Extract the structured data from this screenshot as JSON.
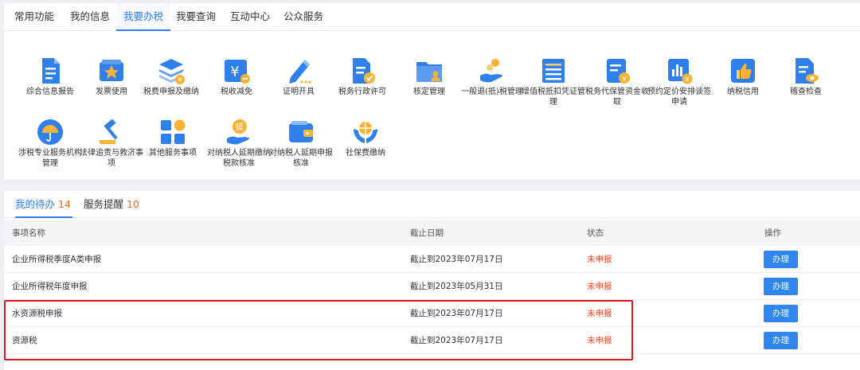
{
  "tabs": [
    "常用功能",
    "我的信息",
    "我要办税",
    "我要查询",
    "互动中心",
    "公众服务"
  ],
  "active_tab": 2,
  "functions": [
    {
      "label": "综合信息报告",
      "icon": "document-report-icon"
    },
    {
      "label": "发票使用",
      "icon": "invoice-star-icon"
    },
    {
      "label": "税费申报及缴纳",
      "icon": "layers-tax-icon"
    },
    {
      "label": "税收减免",
      "icon": "yuan-minus-icon"
    },
    {
      "label": "证明开具",
      "icon": "pen-icon"
    },
    {
      "label": "税务行政许可",
      "icon": "document-check-icon"
    },
    {
      "label": "核定管理",
      "icon": "folder-person-icon"
    },
    {
      "label": "一般退(抵)税管理",
      "icon": "hand-coin-icon"
    },
    {
      "label": "增值税抵扣凭证管理",
      "icon": "ledger-icon"
    },
    {
      "label": "税务代保管资金收取",
      "icon": "document-yuan-icon"
    },
    {
      "label": "预约定价安排谈签申请",
      "icon": "chart-yuan-icon"
    },
    {
      "label": "纳税信用",
      "icon": "thumbs-up-icon"
    },
    {
      "label": "稽查检查",
      "icon": "document-eye-icon"
    },
    {
      "label": "涉税专业服务机构管理",
      "icon": "umbrella-icon"
    },
    {
      "label": "法律追责与救济事项",
      "icon": "gavel-icon"
    },
    {
      "label": "其他服务事项",
      "icon": "grid-icon"
    },
    {
      "label": "对纳税人延期缴纳税款核准",
      "icon": "hand-delay-icon"
    },
    {
      "label": "对纳税人延期申报核准",
      "icon": "wallet-icon"
    },
    {
      "label": "社保费缴纳",
      "icon": "globe-hands-icon"
    }
  ],
  "subtabs": [
    {
      "label": "我的待办",
      "count": "14"
    },
    {
      "label": "服务提醒",
      "count": "10"
    }
  ],
  "table": {
    "headers": [
      "事项名称",
      "截止日期",
      "状态",
      "操作"
    ],
    "rows": [
      {
        "name": "企业所得税季度A类申报",
        "deadline": "截止到2023年07月17日",
        "status": "未申报",
        "action": "办理"
      },
      {
        "name": "企业所得税年度申报",
        "deadline": "截止到2023年05月31日",
        "status": "未申报",
        "action": "办理"
      },
      {
        "name": "水资源税申报",
        "deadline": "截止到2023年07月17日",
        "status": "未申报",
        "action": "办理"
      },
      {
        "name": "资源税",
        "deadline": "截止到2023年07月17日",
        "status": "未申报",
        "action": "办理"
      }
    ]
  },
  "colors": {
    "accent": "#2f7df6",
    "status_red": "#f04a28",
    "count_orange": "#f26a1b",
    "highlight_red": "#d8191f",
    "button_blue": "#2f86ee"
  }
}
